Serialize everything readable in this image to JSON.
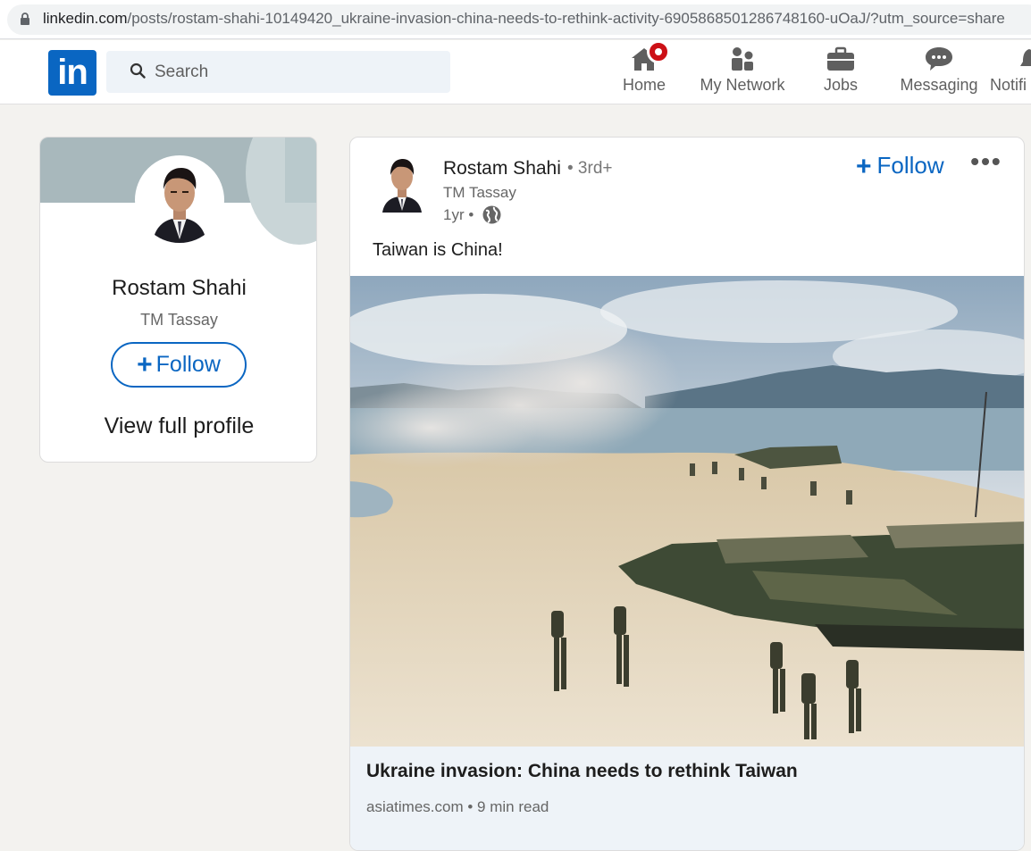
{
  "browser": {
    "url_domain": "linkedin.com",
    "url_path": "/posts/rostam-shahi-10149420_ukraine-invasion-china-needs-to-rethink-activity-6905868501286748160-uOaJ/?utm_source=share"
  },
  "nav": {
    "logo_text": "in",
    "search_placeholder": "Search",
    "items": [
      {
        "label": "Home",
        "icon": "home-icon"
      },
      {
        "label": "My Network",
        "icon": "network-icon"
      },
      {
        "label": "Jobs",
        "icon": "briefcase-icon"
      },
      {
        "label": "Messaging",
        "icon": "message-icon"
      },
      {
        "label": "Notifi",
        "icon": "bell-icon"
      }
    ]
  },
  "profile_card": {
    "name": "Rostam Shahi",
    "company": "TM Tassay",
    "follow_label": "Follow",
    "view_profile_label": "View full profile"
  },
  "post": {
    "author": "Rostam Shahi",
    "degree": "• 3rd+",
    "headline": "TM Tassay",
    "time": "1yr •",
    "follow_label": "Follow",
    "more_label": "•••",
    "text": "Taiwan is China!",
    "link_title": "Ukraine invasion: China needs to rethink Taiwan",
    "link_meta": "asiatimes.com • 9 min read"
  },
  "colors": {
    "brand": "#0a66c2",
    "notification_badge": "#cc1016",
    "background": "#f3f2ef"
  }
}
